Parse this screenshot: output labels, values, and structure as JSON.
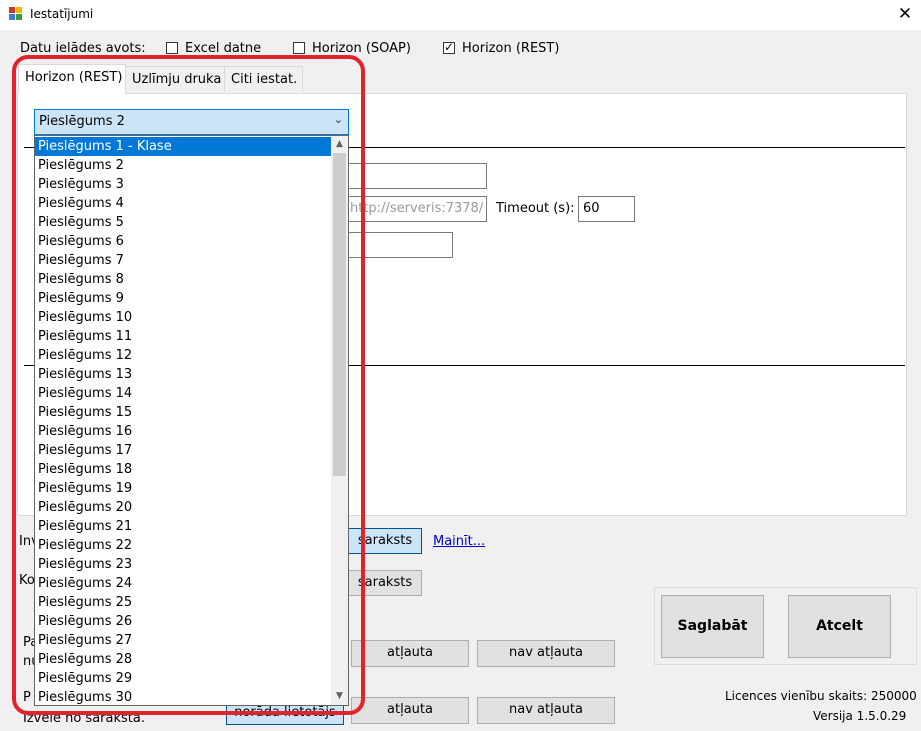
{
  "window": {
    "title": "Iestatījumi"
  },
  "data_source": {
    "label": "Datu ielādes avots:",
    "options": [
      {
        "label": "Excel datne",
        "checked": false
      },
      {
        "label": "Horizon (SOAP)",
        "checked": false
      },
      {
        "label": "Horizon (REST)",
        "checked": true
      }
    ]
  },
  "tabs": [
    "Horizon (REST)",
    "Uzlīmju druka",
    "Citi iestat."
  ],
  "connection_select": {
    "selected": "Pieslēgums 2",
    "highlighted": "Pieslēgums 1 - Klase",
    "options": [
      "Pieslēgums 1 - Klase",
      "Pieslēgums 2",
      "Pieslēgums 3",
      "Pieslēgums 4",
      "Pieslēgums 5",
      "Pieslēgums 6",
      "Pieslēgums 7",
      "Pieslēgums 8",
      "Pieslēgums 9",
      "Pieslēgums 10",
      "Pieslēgums 11",
      "Pieslēgums 12",
      "Pieslēgums 13",
      "Pieslēgums 14",
      "Pieslēgums 15",
      "Pieslēgums 16",
      "Pieslēgums 17",
      "Pieslēgums 18",
      "Pieslēgums 19",
      "Pieslēgums 20",
      "Pieslēgums 21",
      "Pieslēgums 22",
      "Pieslēgums 23",
      "Pieslēgums 24",
      "Pieslēgums 25",
      "Pieslēgums 26",
      "Pieslēgums 27",
      "Pieslēgums 28",
      "Pieslēgums 29",
      "Pieslēgums 30"
    ]
  },
  "rest_fields": {
    "url_placeholder": "http://serveris:7378/",
    "timeout_label": "Timeout (s):",
    "timeout_value": "60"
  },
  "lower": {
    "row1_label_fragment": "Inv",
    "row1_button": "saraksts",
    "row1_link": "Mainīt...",
    "row2_label_fragment": "Ko",
    "row2_button": "saraksts",
    "row3_label_fragment_a": "Pa",
    "row3_label_fragment_b": "nu",
    "row3_btn_allowed": "atļauta",
    "row3_btn_not_allowed": "nav atļauta",
    "row4_label_fragment_a": "P",
    "row4_label_fragment_b": "Izvēle no saraksta.",
    "row4_btn_user": "norāda lietotājs",
    "row4_btn_allowed": "atļauta",
    "row4_btn_not_allowed": "nav atļauta"
  },
  "actions": {
    "save": "Saglabāt",
    "cancel": "Atcelt"
  },
  "footer": {
    "licence": "Licences vienību skaits: 250000",
    "version": "Versija 1.5.0.29"
  },
  "colors": {
    "highlight_box": "#e0242e",
    "selection": "#0078d7",
    "combo_focus": "#cce4f7"
  }
}
